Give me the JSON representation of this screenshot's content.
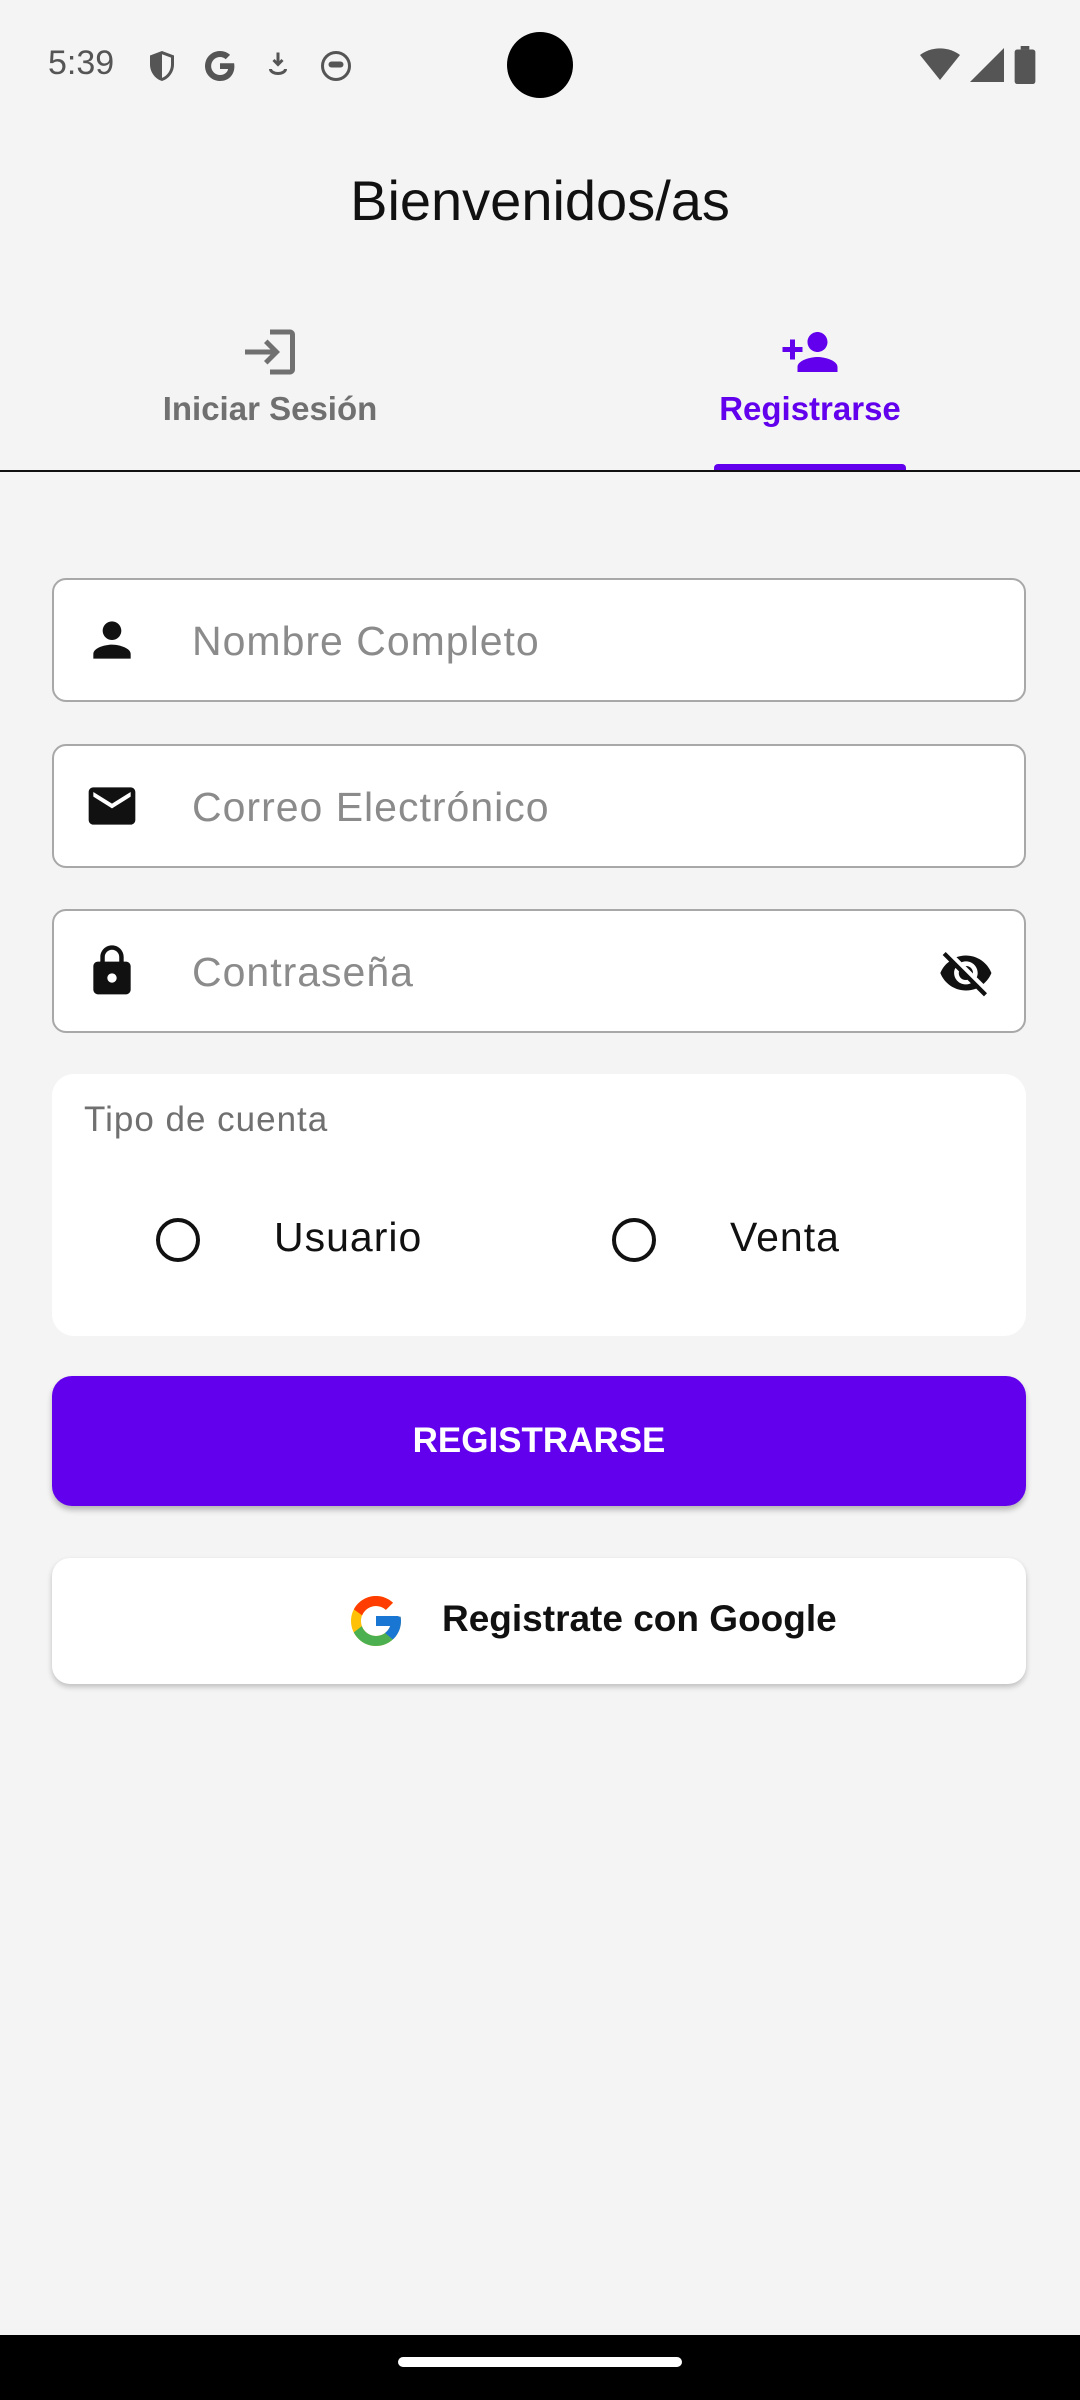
{
  "status_bar": {
    "time": "5:39",
    "left_icons": [
      "shield-icon",
      "google-icon",
      "download-icon",
      "face-icon"
    ],
    "right_icons": [
      "wifi-icon",
      "signal-icon",
      "battery-icon"
    ]
  },
  "header": {
    "title": "Bienvenidos/as"
  },
  "tabs": [
    {
      "label": "Iniciar Sesión",
      "icon": "login-icon",
      "active": false
    },
    {
      "label": "Registrarse",
      "icon": "person-add-icon",
      "active": true
    }
  ],
  "form": {
    "full_name": {
      "placeholder": "Nombre Completo",
      "value": "",
      "icon": "person-icon"
    },
    "email": {
      "placeholder": "Correo Electrónico",
      "value": "",
      "icon": "mail-icon"
    },
    "password": {
      "placeholder": "Contraseña",
      "value": "",
      "icon": "lock-icon",
      "toggle_icon": "eye-off-icon"
    },
    "account_type": {
      "label": "Tipo de cuenta",
      "options": [
        {
          "label": "Usuario",
          "selected": false
        },
        {
          "label": "Venta",
          "selected": false
        }
      ]
    },
    "submit_label": "REGISTRARSE",
    "google_label": "Registrate con Google"
  },
  "colors": {
    "accent": "#6200ee",
    "background": "#f4f4f4",
    "inactive_tab": "#707070"
  }
}
